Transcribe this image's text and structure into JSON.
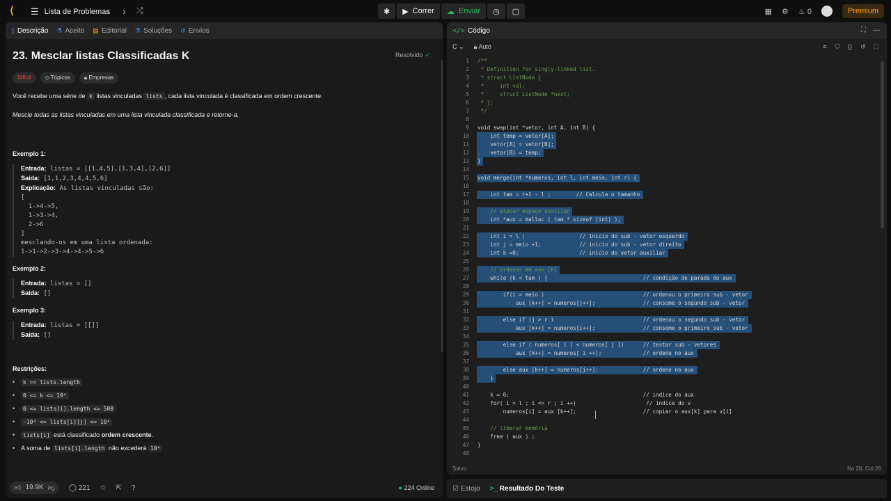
{
  "topbar": {
    "problem_list": "Lista de Problemas",
    "run": "Correr",
    "submit": "Enviar",
    "streak": "0",
    "premium": "Premium"
  },
  "left": {
    "tabs": [
      {
        "label": "Descrição"
      },
      {
        "label": "Aceito"
      },
      {
        "label": "Editorial"
      },
      {
        "label": "Soluções"
      },
      {
        "label": "Envios"
      }
    ],
    "title": "23. Mesclar listas Classificadas K",
    "solved": "Resolvido",
    "chips": [
      "Difícil",
      "Tópicos",
      "Empresas"
    ],
    "desc_a": "Você recebe uma série de",
    "desc_k": "k",
    "desc_b": "listas vinculadas",
    "desc_lists": "lists",
    "desc_c": ", cada lista vinculada é classificada em ordem crescente.",
    "desc2": "Mescle todas as listas vinculadas em uma lista vinculada classificada e retorne-a.",
    "ex1_title": "Exemplo 1:",
    "ex1_in_label": "Entrada:",
    "ex1_in": "listas = [[1,4,5],[1,3,4],[2,6]]",
    "ex1_out_label": "Saída:",
    "ex1_out": "[1,1,2,3,4,4,5,6]",
    "ex1_expl_label": "Explicação:",
    "ex1_expl": "As listas vinculadas são:",
    "ex1_lines": [
      "[",
      "  1->4->5,",
      "  1->3->4,",
      "  2->6",
      "]",
      "mesclando-os em uma lista ordenada:",
      "1->1->2->3->4->4->5->6"
    ],
    "ex2_title": "Exemplo 2:",
    "ex2_in_label": "Entrada:",
    "ex2_in": "listas = []",
    "ex2_out_label": "Saída:",
    "ex2_out": "[]",
    "ex3_title": "Exemplo 3:",
    "ex3_in_label": "Entrada:",
    "ex3_in": "listas = [[]]",
    "ex3_out_label": "Saída:",
    "ex3_out": "[]",
    "constraints_title": "Restrições:",
    "c1": "k == lists.length",
    "c2": "0 <= k <= 10⁴",
    "c3": "0 <= lists[i].length <= 500",
    "c4": "-10⁴ <= lists[i][j] <= 10⁴",
    "c5_code": "lists[i]",
    "c5_text": "está classificado",
    "c5_bold": "ordem crescente",
    "c6_a": "A soma de",
    "c6_code": "lists[i].length",
    "c6_b": "não excederá",
    "c6_code2": "10⁴",
    "likes": "19.9K",
    "comments": "221",
    "online": "224 Online"
  },
  "right": {
    "title": "Código",
    "lang": "C",
    "auto": "Auto",
    "status": "Salvo",
    "position": "No 28, Col 26"
  },
  "code_lines": [
    "/**",
    " * Definition for singly-linked list.",
    " * struct ListNode {",
    " *     int val;",
    " *     struct ListNode *next;",
    " * };",
    " */",
    "",
    "void swap(int *vetor, int A, int B) {",
    "    int temp = vetor[A];",
    "    vetor[A] = vetor[B];",
    "    vetor[B] = temp;",
    "}",
    "",
    "void merge(int *numeros, int l, int meio, int r) {",
    "",
    "    int tam = r+1 - l ;        // Calcula o tamanho",
    "",
    "    // alocar espaço auxiliar",
    "    int *aux = malloc ( tam * sizeof (int) );",
    "",
    "    int i = l ;                 // inicio do sub - vetor esquerdo",
    "    int j = meio +1;            // inicio do sub - vetor direito",
    "    int k =0;                   // inicio do vetor auxiliar",
    "",
    "    // ordenar em aux [k]",
    "    while (k < tam ) {                              // condição de parada do aux",
    "",
    "        if(i > meio )                               // ordenou o primeiro sub - vetor",
    "            aux [k++] = numeros[j++];               // consome o segundo sub - vetor",
    "",
    "        else if (j > r )                            // ordenou o segundo sub - vetor",
    "            aux [k++] = numeros[i++];               // consome o primeiro sub - vetor",
    "",
    "        else if ( numeros[ i ] < numeros[ j ])      // testar sub - vetores",
    "            aux [k++] = numeros[ i ++];             // ordene no aux",
    "",
    "        else aux [k++] = numeros[j++];              // ordene no aux",
    "    }",
    "",
    "    k = 0;                                          // indice do aux",
    "    for( i = l ; i <= r ; i ++)                      // indice do v",
    "        numeros[i] = aux [k++];                     // copiar o aux[k] para v[i]",
    "",
    "    // liberar memória",
    "    free ( aux ) ;",
    "}",
    ""
  ],
  "bottom": {
    "tab1": "Estojo",
    "tab2": "Resultado Do Teste"
  }
}
